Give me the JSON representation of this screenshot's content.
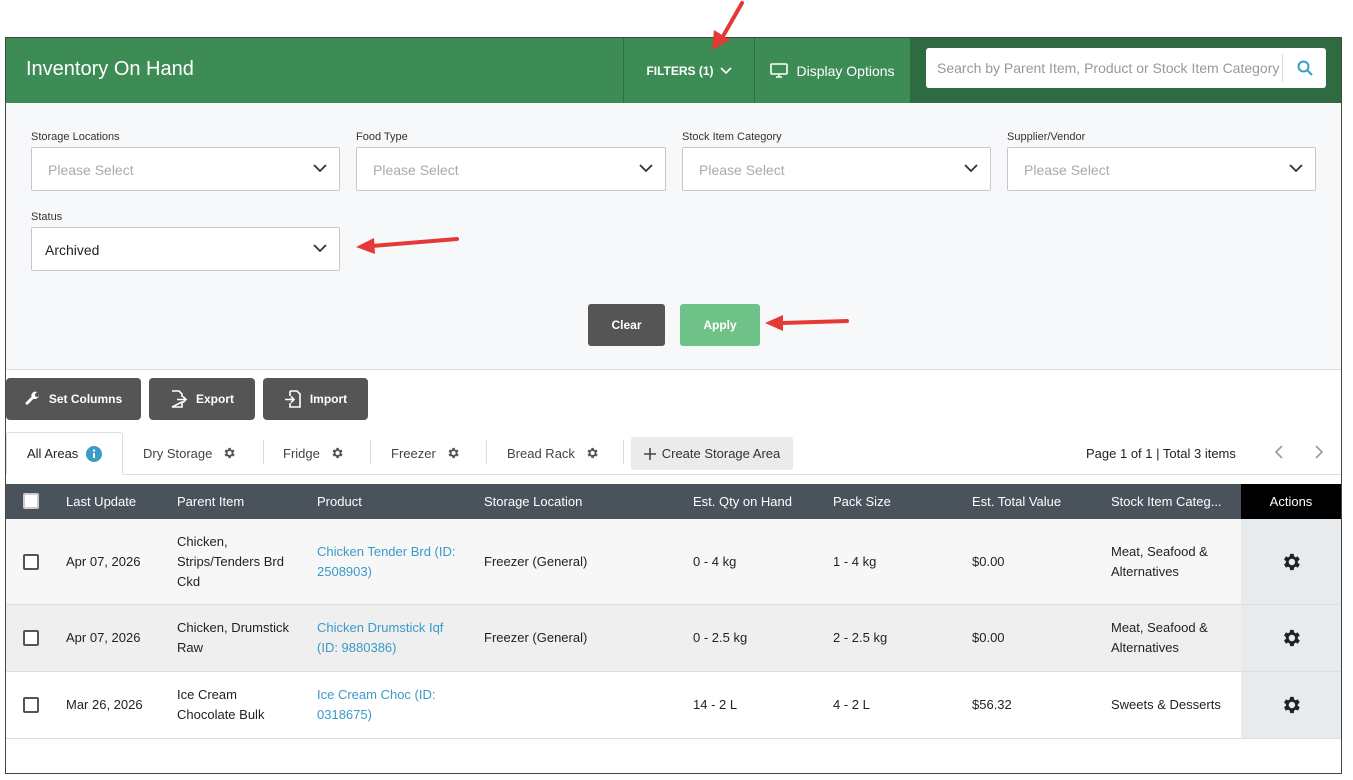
{
  "header": {
    "title": "Inventory On Hand",
    "filters_label": "FILTERS (1)",
    "display_options_label": "Display Options",
    "search_placeholder": "Search by Parent Item, Product or Stock Item Category"
  },
  "filters": {
    "storage_locations": {
      "label": "Storage Locations",
      "value": "Please Select"
    },
    "food_type": {
      "label": "Food Type",
      "value": "Please Select"
    },
    "stock_item_category": {
      "label": "Stock Item Category",
      "value": "Please Select"
    },
    "supplier_vendor": {
      "label": "Supplier/Vendor",
      "value": "Please Select"
    },
    "status": {
      "label": "Status",
      "value": "Archived"
    },
    "clear_label": "Clear",
    "apply_label": "Apply"
  },
  "toolbar": {
    "set_columns": "Set Columns",
    "export": "Export",
    "import": "Import"
  },
  "tabs": {
    "all_areas": "All Areas",
    "dry_storage": "Dry Storage",
    "fridge": "Fridge",
    "freezer": "Freezer",
    "bread_rack": "Bread Rack",
    "create": "Create Storage Area"
  },
  "pager": {
    "page": "Page 1 of 1",
    "sep": "|",
    "total": "Total 3 items"
  },
  "table": {
    "columns": {
      "last_update": "Last Update",
      "parent_item": "Parent Item",
      "product": "Product",
      "storage_location": "Storage Location",
      "est_qty": "Est. Qty on Hand",
      "pack_size": "Pack Size",
      "est_total": "Est. Total Value",
      "stock_cat": "Stock Item Categ...",
      "actions": "Actions"
    },
    "rows": [
      {
        "last_update": "Apr 07, 2026",
        "parent_item": [
          "Chicken,",
          "Strips/Tenders Brd",
          "Ckd"
        ],
        "product": [
          "Chicken Tender Brd (ID:",
          "2508903)"
        ],
        "storage_location": "Freezer (General)",
        "est_qty": "0 - 4 kg",
        "pack_size": "1 - 4 kg",
        "est_total": "$0.00",
        "stock_cat": [
          "Meat, Seafood &",
          "Alternatives"
        ]
      },
      {
        "last_update": "Apr 07, 2026",
        "parent_item": [
          "Chicken, Drumstick",
          "Raw"
        ],
        "product": [
          "Chicken Drumstick Iqf",
          "(ID: 9880386)"
        ],
        "storage_location": "Freezer (General)",
        "est_qty": "0 - 2.5 kg",
        "pack_size": "2 - 2.5 kg",
        "est_total": "$0.00",
        "stock_cat": [
          "Meat, Seafood &",
          "Alternatives"
        ]
      },
      {
        "last_update": "Mar 26, 2026",
        "parent_item": [
          "Ice Cream",
          "Chocolate Bulk"
        ],
        "product": [
          "Ice Cream Choc (ID:",
          "0318675)"
        ],
        "storage_location": "",
        "est_qty": "14 - 2 L",
        "pack_size": "4 - 2 L",
        "est_total": "$56.32",
        "stock_cat": [
          "Sweets & Desserts"
        ]
      }
    ]
  },
  "colors": {
    "header_green": "#3d8b55",
    "apply_green": "#6fc287",
    "link_blue": "#3a9bc8",
    "annotation_red": "#e53935"
  }
}
